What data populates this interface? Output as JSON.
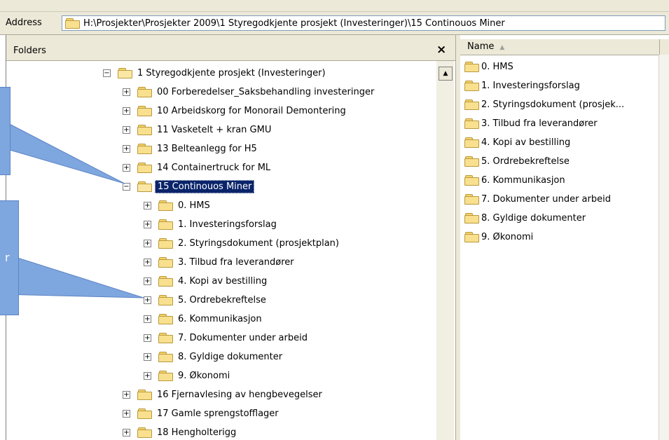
{
  "address_bar": {
    "label": "Address",
    "path": "H:\\Prosjekter\\Prosjekter 2009\\1 Styregodkjente prosjekt (Investeringer)\\15 Continouos Miner"
  },
  "folders_pane": {
    "title": "Folders",
    "close_symbol": "×",
    "tree": [
      {
        "label": "1 Styregodkjente prosjekt (Investeringer)",
        "expander": "−"
      },
      {
        "label": "00 Forberedelser_Saksbehandling investeringer",
        "expander": "+"
      },
      {
        "label": "10 Arbeidskorg for Monorail Demontering",
        "expander": "+"
      },
      {
        "label": "11 Vasketelt + kran GMU",
        "expander": "+"
      },
      {
        "label": "13 Belteanlegg for H5",
        "expander": "+"
      },
      {
        "label": "14 Containertruck for ML",
        "expander": "+"
      },
      {
        "label": "15 Continouos Miner",
        "expander": "−"
      },
      {
        "label": "0. HMS",
        "expander": "+"
      },
      {
        "label": "1. Investeringsforslag",
        "expander": "+"
      },
      {
        "label": "2. Styringsdokument (prosjektplan)",
        "expander": "+"
      },
      {
        "label": "3. Tilbud fra leverandører",
        "expander": "+"
      },
      {
        "label": "4. Kopi av bestilling",
        "expander": "+"
      },
      {
        "label": "5. Ordrebekreftelse",
        "expander": "+"
      },
      {
        "label": "6. Kommunikasjon",
        "expander": "+"
      },
      {
        "label": "7. Dokumenter under arbeid",
        "expander": "+"
      },
      {
        "label": "8. Gyldige dokumenter",
        "expander": "+"
      },
      {
        "label": "9. Økonomi",
        "expander": "+"
      },
      {
        "label": "16 Fjernavlesing av hengbevegelser",
        "expander": "+"
      },
      {
        "label": "17 Gamle sprengstofflager",
        "expander": "+"
      },
      {
        "label": "18 Hengholterigg",
        "expander": "+"
      }
    ],
    "scroll_up_symbol": "▲"
  },
  "list_pane": {
    "column_name": "Name",
    "sort_symbol": "▲",
    "items": [
      "0. HMS",
      "1. Investeringsforslag",
      "2. Styringsdokument (prosjek...",
      "3. Tilbud fra leverandører",
      "4. Kopi av bestilling",
      "5. Ordrebekreftelse",
      "6. Kommunikasjon",
      "7. Dokumenter under arbeid",
      "8. Gyldige dokumenter",
      "9. Økonomi"
    ]
  },
  "callouts": {
    "second_fragment": "r"
  },
  "colors": {
    "selection": "#0a246a",
    "callout": "#7ea6df",
    "chrome": "#ece9d8"
  }
}
